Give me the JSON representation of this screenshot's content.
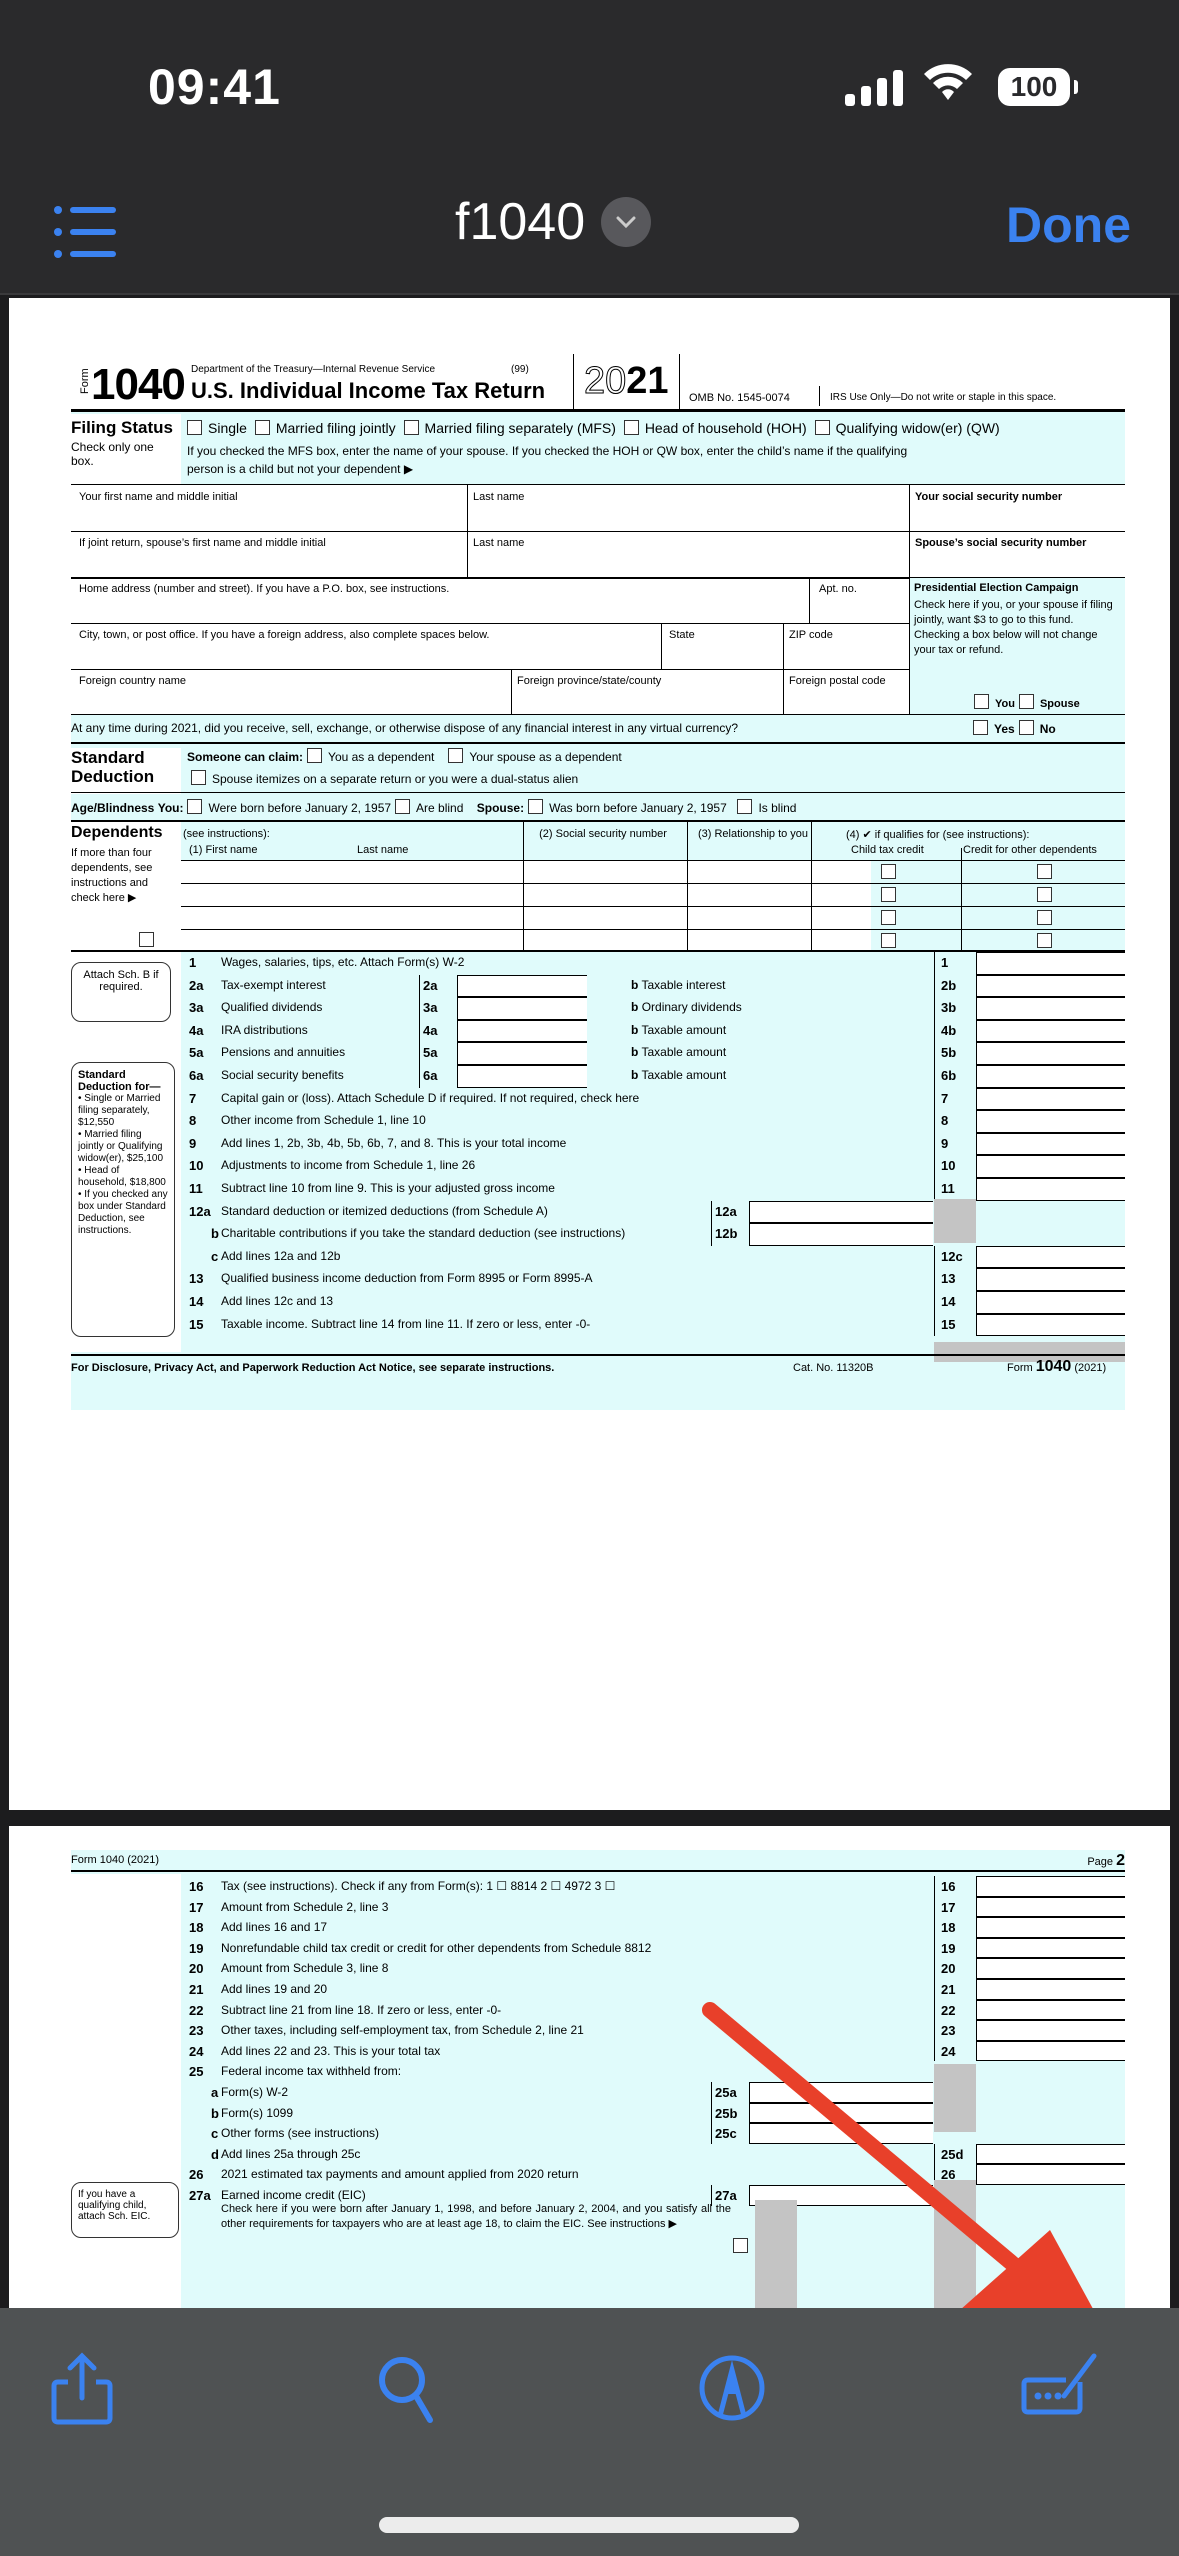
{
  "status": {
    "time": "09:41",
    "battery": "100"
  },
  "nav": {
    "title": "f1040",
    "done": "Done"
  },
  "colors": {
    "accent": "#3b82f0",
    "form_bg": "#e0fbfb",
    "arrow": "#e8402a"
  },
  "page1": {
    "form_label": "Form",
    "form_number": "1040",
    "dept": "Department of the Treasury—Internal Revenue Service",
    "code": "(99)",
    "title": "U.S. Individual Income Tax Return",
    "year_outline": "20",
    "year_bold": "21",
    "omb": "OMB No. 1545-0074",
    "irs_use": "IRS Use Only—Do not write or staple in this space.",
    "filing_status": {
      "heading": "Filing Status",
      "sub": "Check only one box.",
      "options": [
        "Single",
        "Married filing jointly",
        "Married filing separately (MFS)",
        "Head of household (HOH)",
        "Qualifying widow(er) (QW)"
      ],
      "note1": "If you checked the MFS box, enter the name of your spouse. If you checked the HOH or QW box, enter the child’s name if the qualifying",
      "note2": "person is a child but not your dependent ▶"
    },
    "name_fields": {
      "first": "Your first name and middle initial",
      "last": "Last name",
      "ssn": "Your social security number",
      "spouse_first": "If joint return, spouse’s first name and middle initial",
      "spouse_last": "Last name",
      "spouse_ssn": "Spouse’s social security number",
      "address": "Home address (number and street). If you have a P.O. box, see instructions.",
      "apt": "Apt. no.",
      "city": "City, town, or post office. If you have a foreign address, also complete spaces below.",
      "state": "State",
      "zip": "ZIP code",
      "country": "Foreign country name",
      "province": "Foreign province/state/county",
      "postal": "Foreign postal code"
    },
    "pec": {
      "title": "Presidential Election Campaign",
      "text": "Check here if you, or your spouse if filing jointly, want $3 to go to this fund. Checking a box below will not change your tax or refund.",
      "you": "You",
      "spouse": "Spouse"
    },
    "virtual_currency": {
      "question": "At any time during 2021, did you receive, sell, exchange, or otherwise dispose of any financial interest in any virtual currency?",
      "yes": "Yes",
      "no": "No"
    },
    "standard_deduction": {
      "heading1": "Standard",
      "heading2": "Deduction",
      "someone": "Someone can claim:",
      "you_dep": "You as a dependent",
      "spouse_dep": "Your spouse as a dependent",
      "itemizes": "Spouse itemizes on a separate return or you were a dual-status alien"
    },
    "age_blindness": {
      "heading": "Age/Blindness",
      "you": "You:",
      "you_born": "Were born before January 2, 1957",
      "you_blind": "Are blind",
      "spouse": "Spouse:",
      "spouse_born": "Was born before January 2, 1957",
      "spouse_blind": "Is blind"
    },
    "dependents": {
      "heading": "Dependents",
      "see": "(see instructions):",
      "side_note": "If more than four dependents, see instructions and check here ▶",
      "col1": "(1) First name",
      "col1b": "Last name",
      "col2": "(2) Social security number",
      "col3": "(3) Relationship to you",
      "col4": "(4) ✔ if qualifies for (see instructions):",
      "col4a": "Child tax credit",
      "col4b": "Credit for other dependents"
    },
    "callout_b": "Attach Sch. B if required.",
    "callout_sd": {
      "title": "Standard Deduction for—",
      "items": [
        "• Single or Married filing separately, $12,550",
        "• Married filing jointly or Qualifying widow(er), $25,100",
        "• Head of household, $18,800",
        "• If you checked any box under Standard Deduction, see instructions."
      ]
    },
    "lines": [
      {
        "no": "1",
        "text": "Wages, salaries, tips, etc. Attach Form(s) W-2",
        "box": "1"
      },
      {
        "no": "2a",
        "text": "Tax-exempt interest",
        "mid": "2a",
        "b": "Taxable interest",
        "box": "2b"
      },
      {
        "no": "3a",
        "text": "Qualified dividends",
        "mid": "3a",
        "b": "Ordinary dividends",
        "box": "3b"
      },
      {
        "no": "4a",
        "text": "IRA distributions",
        "mid": "4a",
        "b": "Taxable amount",
        "box": "4b"
      },
      {
        "no": "5a",
        "text": "Pensions and annuities",
        "mid": "5a",
        "b": "Taxable amount",
        "box": "5b"
      },
      {
        "no": "6a",
        "text": "Social security benefits",
        "mid": "6a",
        "b": "Taxable amount",
        "box": "6b"
      },
      {
        "no": "7",
        "text": "Capital gain or (loss). Attach Schedule D if required. If not required, check here",
        "box": "7"
      },
      {
        "no": "8",
        "text": "Other income from Schedule 1, line 10",
        "box": "8"
      },
      {
        "no": "9",
        "text": "Add lines 1, 2b, 3b, 4b, 5b, 6b, 7, and 8. This is your total income",
        "box": "9"
      },
      {
        "no": "10",
        "text": "Adjustments to income from Schedule 1, line 26",
        "box": "10"
      },
      {
        "no": "11",
        "text": "Subtract line 10 from line 9. This is your adjusted gross income",
        "box": "11"
      },
      {
        "no": "12a",
        "text": "Standard deduction or itemized deductions (from Schedule A)",
        "mid": "12a"
      },
      {
        "no": "b",
        "text": "Charitable contributions if you take the standard deduction (see instructions)",
        "mid": "12b"
      },
      {
        "no": "c",
        "text": "Add lines 12a and 12b",
        "box": "12c"
      },
      {
        "no": "13",
        "text": "Qualified business income deduction from Form 8995 or Form 8995-A",
        "box": "13"
      },
      {
        "no": "14",
        "text": "Add lines 12c and 13",
        "box": "14"
      },
      {
        "no": "15",
        "text": "Taxable income. Subtract line 14 from line 11. If zero or less, enter -0-",
        "box": "15"
      }
    ],
    "footer": {
      "notice": "For Disclosure, Privacy Act, and Paperwork Reduction Act Notice, see separate instructions.",
      "cat": "Cat. No. 11320B",
      "form": "Form",
      "form_no": "1040",
      "form_year": "(2021)"
    }
  },
  "page2": {
    "header_left": "Form 1040 (2021)",
    "header_right": "Page",
    "page_no": "2",
    "lines": [
      {
        "no": "16",
        "text": "Tax (see instructions). Check if any from Form(s): 1 ☐ 8814  2 ☐ 4972  3 ☐",
        "box": "16"
      },
      {
        "no": "17",
        "text": "Amount from Schedule 2, line 3",
        "box": "17"
      },
      {
        "no": "18",
        "text": "Add lines 16 and 17",
        "box": "18"
      },
      {
        "no": "19",
        "text": "Nonrefundable child tax credit or credit for other dependents from Schedule 8812",
        "box": "19"
      },
      {
        "no": "20",
        "text": "Amount from Schedule 3, line 8",
        "box": "20"
      },
      {
        "no": "21",
        "text": "Add lines 19 and 20",
        "box": "21"
      },
      {
        "no": "22",
        "text": "Subtract line 21 from line 18. If zero or less, enter -0-",
        "box": "22"
      },
      {
        "no": "23",
        "text": "Other taxes, including self-employment tax, from Schedule 2, line 21",
        "box": "23"
      },
      {
        "no": "24",
        "text": "Add lines 22 and 23. This is your total tax",
        "box": "24"
      },
      {
        "no": "25",
        "text": "Federal income tax withheld from:"
      },
      {
        "no": "a",
        "text": "Form(s) W-2",
        "mid": "25a"
      },
      {
        "no": "b",
        "text": "Form(s) 1099",
        "mid": "25b"
      },
      {
        "no": "c",
        "text": "Other forms (see instructions)",
        "mid": "25c"
      },
      {
        "no": "d",
        "text": "Add lines 25a through 25c",
        "box": "25d"
      },
      {
        "no": "26",
        "text": "2021 estimated tax payments and amount applied from 2020 return",
        "box": "26"
      },
      {
        "no": "27a",
        "text": "Earned income credit (EIC)",
        "mid": "27a"
      }
    ],
    "eic_note": "Check here if you were born after January 1, 1998, and before January 2, 2004, and you satisfy all the other requirements for taxpayers who are at least age 18, to claim the EIC. See instructions ▶",
    "callout_eic": "If you have a qualifying child, attach Sch. EIC."
  },
  "toolbar": {
    "share": "share-icon",
    "search": "search-icon",
    "markup": "markup-icon",
    "fill_sign": "fill-and-sign-icon"
  }
}
